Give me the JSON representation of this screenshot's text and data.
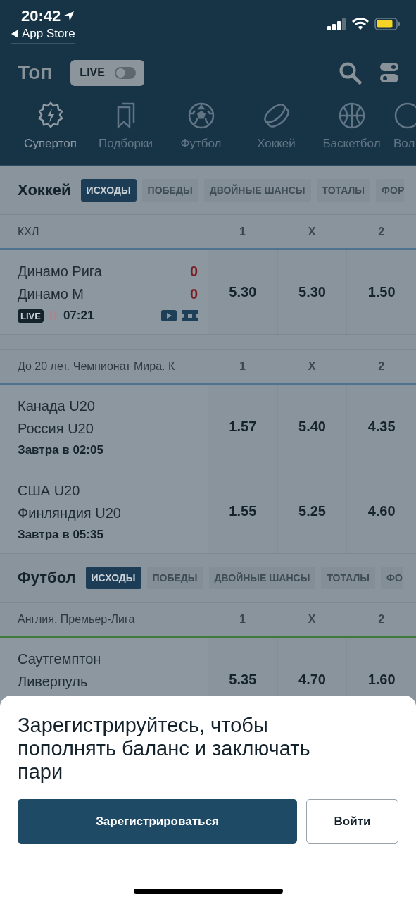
{
  "status_bar": {
    "time": "20:42",
    "back_label": "App Store"
  },
  "header": {
    "title": "Топ",
    "live_toggle": {
      "label": "LIVE",
      "on": false
    }
  },
  "sport_tabs": [
    {
      "label": "Супертоп",
      "kind": "supertop",
      "selected": true
    },
    {
      "label": "Подборки",
      "kind": "collections",
      "selected": false
    },
    {
      "label": "Футбол",
      "kind": "football",
      "selected": false
    },
    {
      "label": "Хоккей",
      "kind": "hockey",
      "selected": false
    },
    {
      "label": "Баскетбол",
      "kind": "basketball",
      "selected": false
    },
    {
      "label": "Вол",
      "kind": "volleyball",
      "selected": false
    }
  ],
  "sections": [
    {
      "title": "Хоккей",
      "markets": [
        {
          "label": "ИСХОДЫ",
          "selected": true
        },
        {
          "label": "ПОБЕДЫ",
          "selected": false
        },
        {
          "label": "ДВОЙНЫЕ ШАНСЫ",
          "selected": false
        },
        {
          "label": "ТОТАЛЫ",
          "selected": false
        },
        {
          "label": "ФОР",
          "selected": false
        }
      ],
      "leagues": [
        {
          "name": "КХЛ",
          "color": "#4d7390",
          "columns": [
            "1",
            "X",
            "2"
          ],
          "events": [
            {
              "kind": "live",
              "teams": [
                {
                  "name": "Динамо Рига",
                  "score": "0"
                },
                {
                  "name": "Динамо М",
                  "score": "0"
                }
              ],
              "badge": "LIVE",
              "clock": "07:21",
              "odds": [
                "5.30",
                "5.30",
                "1.50"
              ]
            }
          ]
        },
        {
          "name": "До 20 лет. Чемпионат Мира. К",
          "color": "#4d7390",
          "columns": [
            "1",
            "X",
            "2"
          ],
          "events": [
            {
              "kind": "scheduled",
              "teams": [
                {
                  "name": "Канада U20"
                },
                {
                  "name": "Россия U20"
                }
              ],
              "start": "Завтра в 02:05",
              "odds": [
                "1.57",
                "5.40",
                "4.35"
              ]
            },
            {
              "kind": "scheduled",
              "teams": [
                {
                  "name": "США U20"
                },
                {
                  "name": "Финляндия U20"
                }
              ],
              "start": "Завтра в 05:35",
              "odds": [
                "1.55",
                "5.25",
                "4.60"
              ]
            }
          ]
        }
      ]
    },
    {
      "title": "Футбол",
      "markets": [
        {
          "label": "ИСХОДЫ",
          "selected": true
        },
        {
          "label": "ПОБЕДЫ",
          "selected": false
        },
        {
          "label": "ДВОЙНЫЕ ШАНСЫ",
          "selected": false
        },
        {
          "label": "ТОТАЛЫ",
          "selected": false
        },
        {
          "label": "ФО",
          "selected": false
        }
      ],
      "leagues": [
        {
          "name": "Англия. Премьер-Лига",
          "color": "#3f7a3c",
          "columns": [
            "1",
            "X",
            "2"
          ],
          "events": [
            {
              "kind": "scheduled",
              "teams": [
                {
                  "name": "Саутгемптон"
                },
                {
                  "name": "Ливерпуль"
                }
              ],
              "odds": [
                "5.35",
                "4.70",
                "1.60"
              ]
            }
          ]
        }
      ]
    }
  ],
  "sheet": {
    "message": "Зарегистрируйтесь, чтобы пополнять баланс и заключать пари",
    "buttons": [
      {
        "label": "Зарегистрироваться",
        "kind": "primary"
      },
      {
        "label": "Войти",
        "kind": "secondary"
      }
    ]
  }
}
